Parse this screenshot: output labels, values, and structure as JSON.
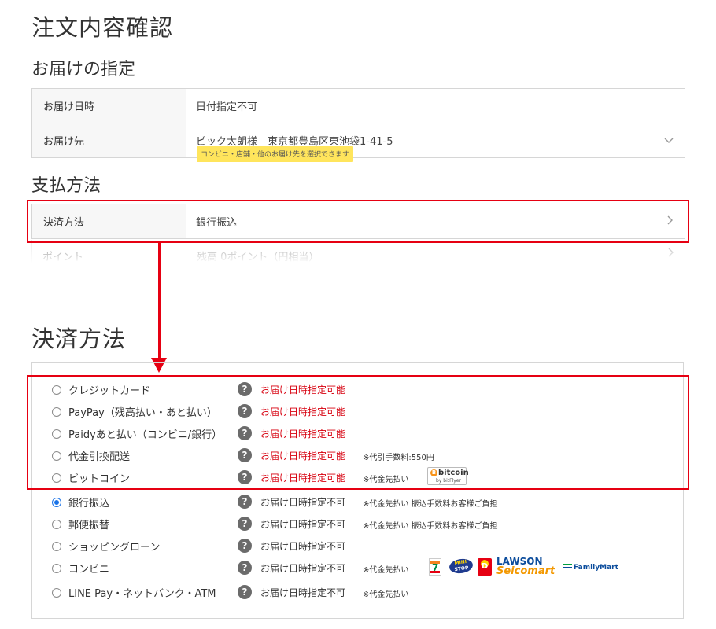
{
  "page_title": "注文内容確認",
  "delivery": {
    "heading": "お届けの指定",
    "rows": [
      {
        "label": "お届け日時",
        "value": "日付指定不可"
      },
      {
        "label": "お届け先",
        "value": "ビック太朗様　東京都豊島区東池袋1-41-5",
        "icon": "chevron-down-icon"
      }
    ],
    "tooltip": "コンビニ・店舗・他のお届け先を選択できます"
  },
  "payment": {
    "heading": "支払方法",
    "rows": [
      {
        "label": "決済方法",
        "value": "銀行振込",
        "icon": "chevron-right-icon"
      },
      {
        "label": "ポイント",
        "value": "残高 0ポイント（円相当）",
        "icon": "chevron-right-icon"
      }
    ]
  },
  "settlement": {
    "heading": "決済方法",
    "methods": [
      {
        "label": "クレジットカード",
        "status": "お届け日時指定可能",
        "note": "",
        "selected": false,
        "delivery_date_available": true
      },
      {
        "label": "PayPay（残高払い・あと払い）",
        "status": "お届け日時指定可能",
        "note": "",
        "selected": false,
        "delivery_date_available": true
      },
      {
        "label": "Paidyあと払い（コンビニ/銀行）",
        "status": "お届け日時指定可能",
        "note": "",
        "selected": false,
        "delivery_date_available": true
      },
      {
        "label": "代金引換配送",
        "status": "お届け日時指定可能",
        "note": "※代引手数料:550円",
        "selected": false,
        "delivery_date_available": true
      },
      {
        "label": "ビットコイン",
        "status": "お届け日時指定可能",
        "note": "※代金先払い",
        "selected": false,
        "delivery_date_available": true,
        "logo": {
          "name": "bitcoin",
          "by": "by bitFlyer"
        }
      },
      {
        "label": "銀行振込",
        "status": "お届け日時指定不可",
        "note": "※代金先払い 振込手数料お客様ご負担",
        "selected": true,
        "delivery_date_available": false
      },
      {
        "label": "郵便振替",
        "status": "お届け日時指定不可",
        "note": "※代金先払い 振込手数料お客様ご負担",
        "selected": false,
        "delivery_date_available": false
      },
      {
        "label": "ショッピングローン",
        "status": "お届け日時指定不可",
        "note": "",
        "selected": false,
        "delivery_date_available": false
      },
      {
        "label": "コンビニ",
        "status": "お届け日時指定不可",
        "note": "※代金先払い",
        "selected": false,
        "delivery_date_available": false,
        "logos": {
          "seven": "7",
          "ministop_top": "MINI",
          "ministop_bottom": "STOP",
          "daily": "D",
          "lawson": "LAWSON",
          "seicomart": "Seicomart",
          "familymart": "FamilyMart"
        }
      },
      {
        "label": "LINE Pay・ネットバンク・ATM",
        "status": "お届け日時指定不可",
        "note": "※代金先払い",
        "selected": false,
        "delivery_date_available": false
      }
    ],
    "help_glyph": "?"
  },
  "colors": {
    "highlight": "#e60012",
    "status_available": "#d7000f",
    "radio_selected": "#1a73e8",
    "tooltip_bg": "#ffe55c"
  }
}
